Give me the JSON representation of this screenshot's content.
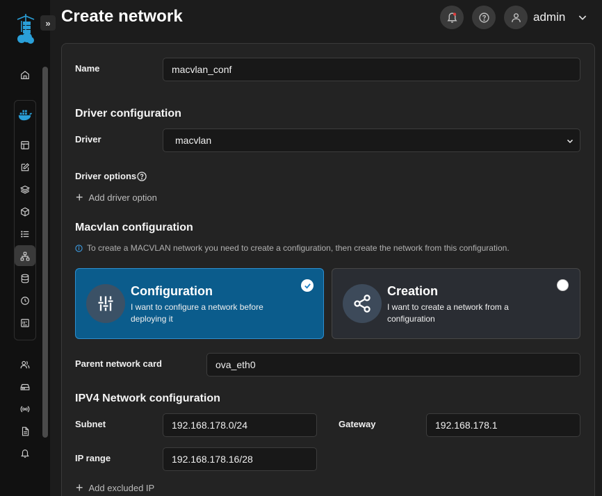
{
  "header": {
    "title": "Create network",
    "user": "admin"
  },
  "sidebar": {
    "items": [
      {
        "icon": "home-icon"
      },
      {
        "icon": "docker-icon"
      },
      {
        "icon": "dashboard-icon"
      },
      {
        "icon": "edit-icon"
      },
      {
        "icon": "layers-icon"
      },
      {
        "icon": "box-icon"
      },
      {
        "icon": "list-icon"
      },
      {
        "icon": "network-icon"
      },
      {
        "icon": "database-icon"
      },
      {
        "icon": "clock-icon"
      },
      {
        "icon": "registry-icon"
      },
      {
        "icon": "users-icon"
      },
      {
        "icon": "drive-icon"
      },
      {
        "icon": "broadcast-icon"
      },
      {
        "icon": "file-icon"
      },
      {
        "icon": "bell-icon"
      }
    ]
  },
  "form": {
    "name_label": "Name",
    "name_value": "macvlan_conf",
    "driver_section": "Driver configuration",
    "driver_label": "Driver",
    "driver_value": "macvlan",
    "driver_options_label": "Driver options",
    "add_driver_option": "Add driver option",
    "macvlan_section": "Macvlan configuration",
    "macvlan_info": "To create a MACVLAN network you need to create a configuration, then create the network from this configuration.",
    "options": [
      {
        "title": "Configuration",
        "desc": "I want to configure a network before deploying it",
        "selected": true
      },
      {
        "title": "Creation",
        "desc": "I want to create a network from a configuration",
        "selected": false
      }
    ],
    "parent_card_label": "Parent network card",
    "parent_card_value": "ova_eth0",
    "ipv4_section": "IPV4 Network configuration",
    "subnet_label": "Subnet",
    "subnet_value": "192.168.178.0/24",
    "gateway_label": "Gateway",
    "gateway_value": "192.168.178.1",
    "ip_range_label": "IP range",
    "ip_range_value": "192.168.178.16/28",
    "add_excluded_ip": "Add excluded IP"
  },
  "colors": {
    "accent": "#0b5c8c",
    "accent_border": "#2d8fd0",
    "background": "#1c1c1c",
    "card": "#232323",
    "sidebar": "#111111"
  }
}
